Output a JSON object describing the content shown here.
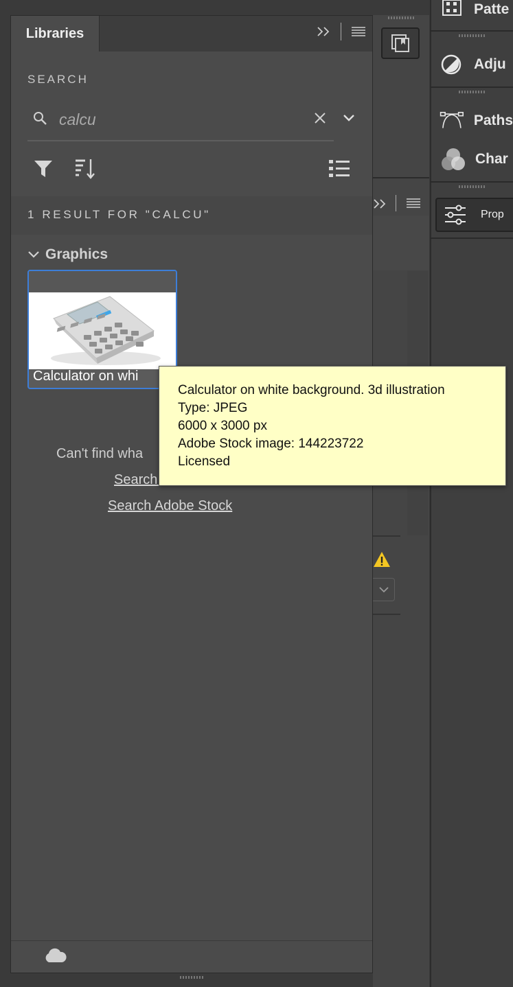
{
  "panel": {
    "tab_label": "Libraries",
    "search_label": "SEARCH",
    "search_value": "calcu",
    "result_count": "1 RESULT FOR \"CALCU\"",
    "group_label": "Graphics",
    "item_caption": "Calculator on whi",
    "help_text": "Can't find wha",
    "link_search_all": "Search all libraries",
    "link_search_stock": "Search Adobe Stock"
  },
  "tooltip": {
    "title": "Calculator on white background. 3d illustration",
    "type": "Type: JPEG",
    "dimensions": "6000 x 3000 px",
    "stock_id": "Adobe Stock image: 144223722",
    "license": "Licensed"
  },
  "dock": {
    "items": [
      {
        "label": "Patte",
        "icon": "patterns-icon"
      },
      {
        "label": "Adju",
        "icon": "adjustments-icon"
      },
      {
        "label": "Paths",
        "icon": "paths-icon"
      },
      {
        "label": "Char",
        "icon": "channels-icon"
      },
      {
        "label": "Prop",
        "icon": "properties-icon"
      }
    ]
  },
  "colors": {
    "accent": "#3d7ed8",
    "tooltip_bg": "#ffffc6",
    "panel_bg": "#4b4b4b",
    "warning": "#f3c623"
  }
}
